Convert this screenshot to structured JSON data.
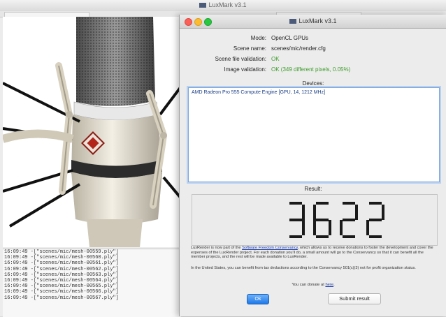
{
  "background_window": {
    "title": "LuxMark v3.1",
    "log_lines": [
      {
        "time": "16:09:49 -",
        "text": "[\"scenes/mic/mesh-00559.ply\"]"
      },
      {
        "time": "16:09:49 -",
        "text": "[\"scenes/mic/mesh-00560.ply\"]"
      },
      {
        "time": "16:09:49 -",
        "text": "[\"scenes/mic/mesh-00561.ply\"]"
      },
      {
        "time": "16:09:49 -",
        "text": "[\"scenes/mic/mesh-00562.ply\"]"
      },
      {
        "time": "16:09:49 -",
        "text": "[\"scenes/mic/mesh-00563.ply\"]"
      },
      {
        "time": "16:09:49 -",
        "text": "[\"scenes/mic/mesh-00564.ply\"]"
      },
      {
        "time": "16:09:49 -",
        "text": "[\"scenes/mic/mesh-00565.ply\"]"
      },
      {
        "time": "16:09:49 -",
        "text": "[\"scenes/mic/mesh-00566.ply\"]"
      },
      {
        "time": "16:09:49 -",
        "text": "[\"scenes/mic/mesh-00567.ply\"]"
      }
    ]
  },
  "dialog": {
    "title": "LuxMark v3.1",
    "fields": [
      {
        "label": "Mode:",
        "value": "OpenCL GPUs",
        "status": "normal"
      },
      {
        "label": "Scene name:",
        "value": "scenes/mic/render.cfg",
        "status": "normal"
      },
      {
        "label": "Scene file validation:",
        "value": "OK",
        "status": "ok"
      },
      {
        "label": "Image validation:",
        "value": "OK (349 different pixels, 0.05%)",
        "status": "ok"
      }
    ],
    "devices_label": "Devices:",
    "devices": [
      "AMD Radeon Pro 555 Compute Engine [GPU, 14, 1212 MHz]"
    ],
    "result_label": "Result:",
    "result_value": "3622",
    "info_part1": "LuxRender is now part of the ",
    "info_link": "Software Freedom Conservancy",
    "info_part2": ", which allows us to receive donations to foster the development and cover the expenses of the LuxRender project. For each donation you'll do, a small amount will go to the Conservancy so that it can benefit all the member projects, and the rest will be made available to LuxRender.",
    "info_us": "In the United States, you can benefit from tax deductions according to the Conservancy 501(c)(3) not for profit organization status.",
    "donate_text": "You can donate at ",
    "donate_link": "here",
    "donate_end": ".",
    "ok_label": "Ok",
    "submit_label": "Submit result"
  },
  "colors": {
    "ok_green": "#3c9c2a",
    "link_blue": "#1a3aa8",
    "accent_blue": "#1f79e8",
    "lcd_digits": "#1a1a1a"
  }
}
